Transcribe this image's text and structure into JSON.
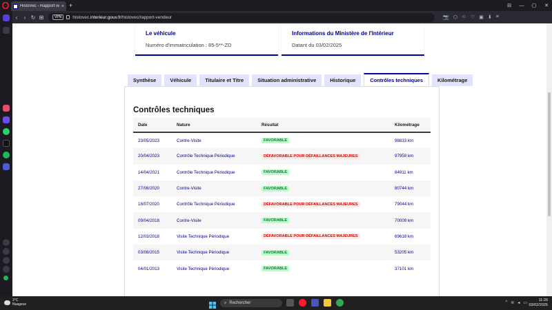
{
  "browser": {
    "tab_title": "HistoVec - Rapport vende",
    "tab_close": "×",
    "new_tab": "+",
    "url_host": "histovec.",
    "url_domain": "interieur.gouv.fr",
    "url_path": "/histovec/rapport-vendeur",
    "vpn_label": "VPN",
    "window_controls": [
      "⊟",
      "—",
      "▢",
      "✕"
    ],
    "nav": [
      "‹",
      "›",
      "↻",
      "⊞"
    ],
    "nav_icons": [
      "📷",
      "⬡",
      "☺",
      "♡",
      "▣",
      "⬇",
      "≡"
    ]
  },
  "cards": {
    "vehicle": {
      "title": "Le véhicule",
      "text": "Numéro d'immatriculation : 85-5**-ZD"
    },
    "ministry": {
      "title": "Informations du Ministère de l'Intérieur",
      "text": "Datant du 03/02/2025"
    }
  },
  "tabs": [
    "Synthèse",
    "Véhicule",
    "Titulaire et Titre",
    "Situation administrative",
    "Historique",
    "Contrôles techniques",
    "Kilométrage"
  ],
  "active_tab": "Contrôles techniques",
  "section_title": "Contrôles techniques",
  "table": {
    "headers": [
      "Date",
      "Nature",
      "Résultat",
      "Kilométrage"
    ],
    "rows": [
      {
        "date": "23/05/2023",
        "nature": "Contre-Visite",
        "result": "FAVORABLE",
        "ok": true,
        "km": "98833 km"
      },
      {
        "date": "20/04/2023",
        "nature": "Contrôle Technique Périodique",
        "result": "DÉFAVORABLE POUR DÉFAILLANCES MAJEURES",
        "ok": false,
        "km": "97959 km"
      },
      {
        "date": "14/04/2021",
        "nature": "Contrôle Technique Périodique",
        "result": "FAVORABLE",
        "ok": true,
        "km": "84911 km"
      },
      {
        "date": "27/08/2020",
        "nature": "Contre-Visite",
        "result": "FAVORABLE",
        "ok": true,
        "km": "80744 km"
      },
      {
        "date": "18/07/2020",
        "nature": "Contrôle Technique Périodique",
        "result": "DÉFAVORABLE POUR DÉFAILLANCES MAJEURES",
        "ok": false,
        "km": "79044 km"
      },
      {
        "date": "09/04/2018",
        "nature": "Contre-Visite",
        "result": "FAVORABLE",
        "ok": true,
        "km": "70009 km"
      },
      {
        "date": "12/03/2018",
        "nature": "Visite Technique Périodique",
        "result": "DÉFAVORABLE POUR DÉFAILLANCES MAJEURES",
        "ok": false,
        "km": "69618 km"
      },
      {
        "date": "03/08/2015",
        "nature": "Visite Technique Périodique",
        "result": "FAVORABLE",
        "ok": true,
        "km": "53205 km"
      },
      {
        "date": "04/01/2013",
        "nature": "Visite Technique Périodique",
        "result": "FAVORABLE",
        "ok": true,
        "km": "37101 km"
      }
    ]
  },
  "taskbar": {
    "weather_temp": "3°C",
    "weather_text": "Nuageux",
    "search_placeholder": "Rechercher",
    "time": "11:29",
    "date": "03/02/2025"
  },
  "colors": {
    "accent": "#000091",
    "ok_bg": "#b8fec9",
    "ok_fg": "#18753c",
    "ko_bg": "#ffe9e6",
    "ko_fg": "#ce0500"
  }
}
